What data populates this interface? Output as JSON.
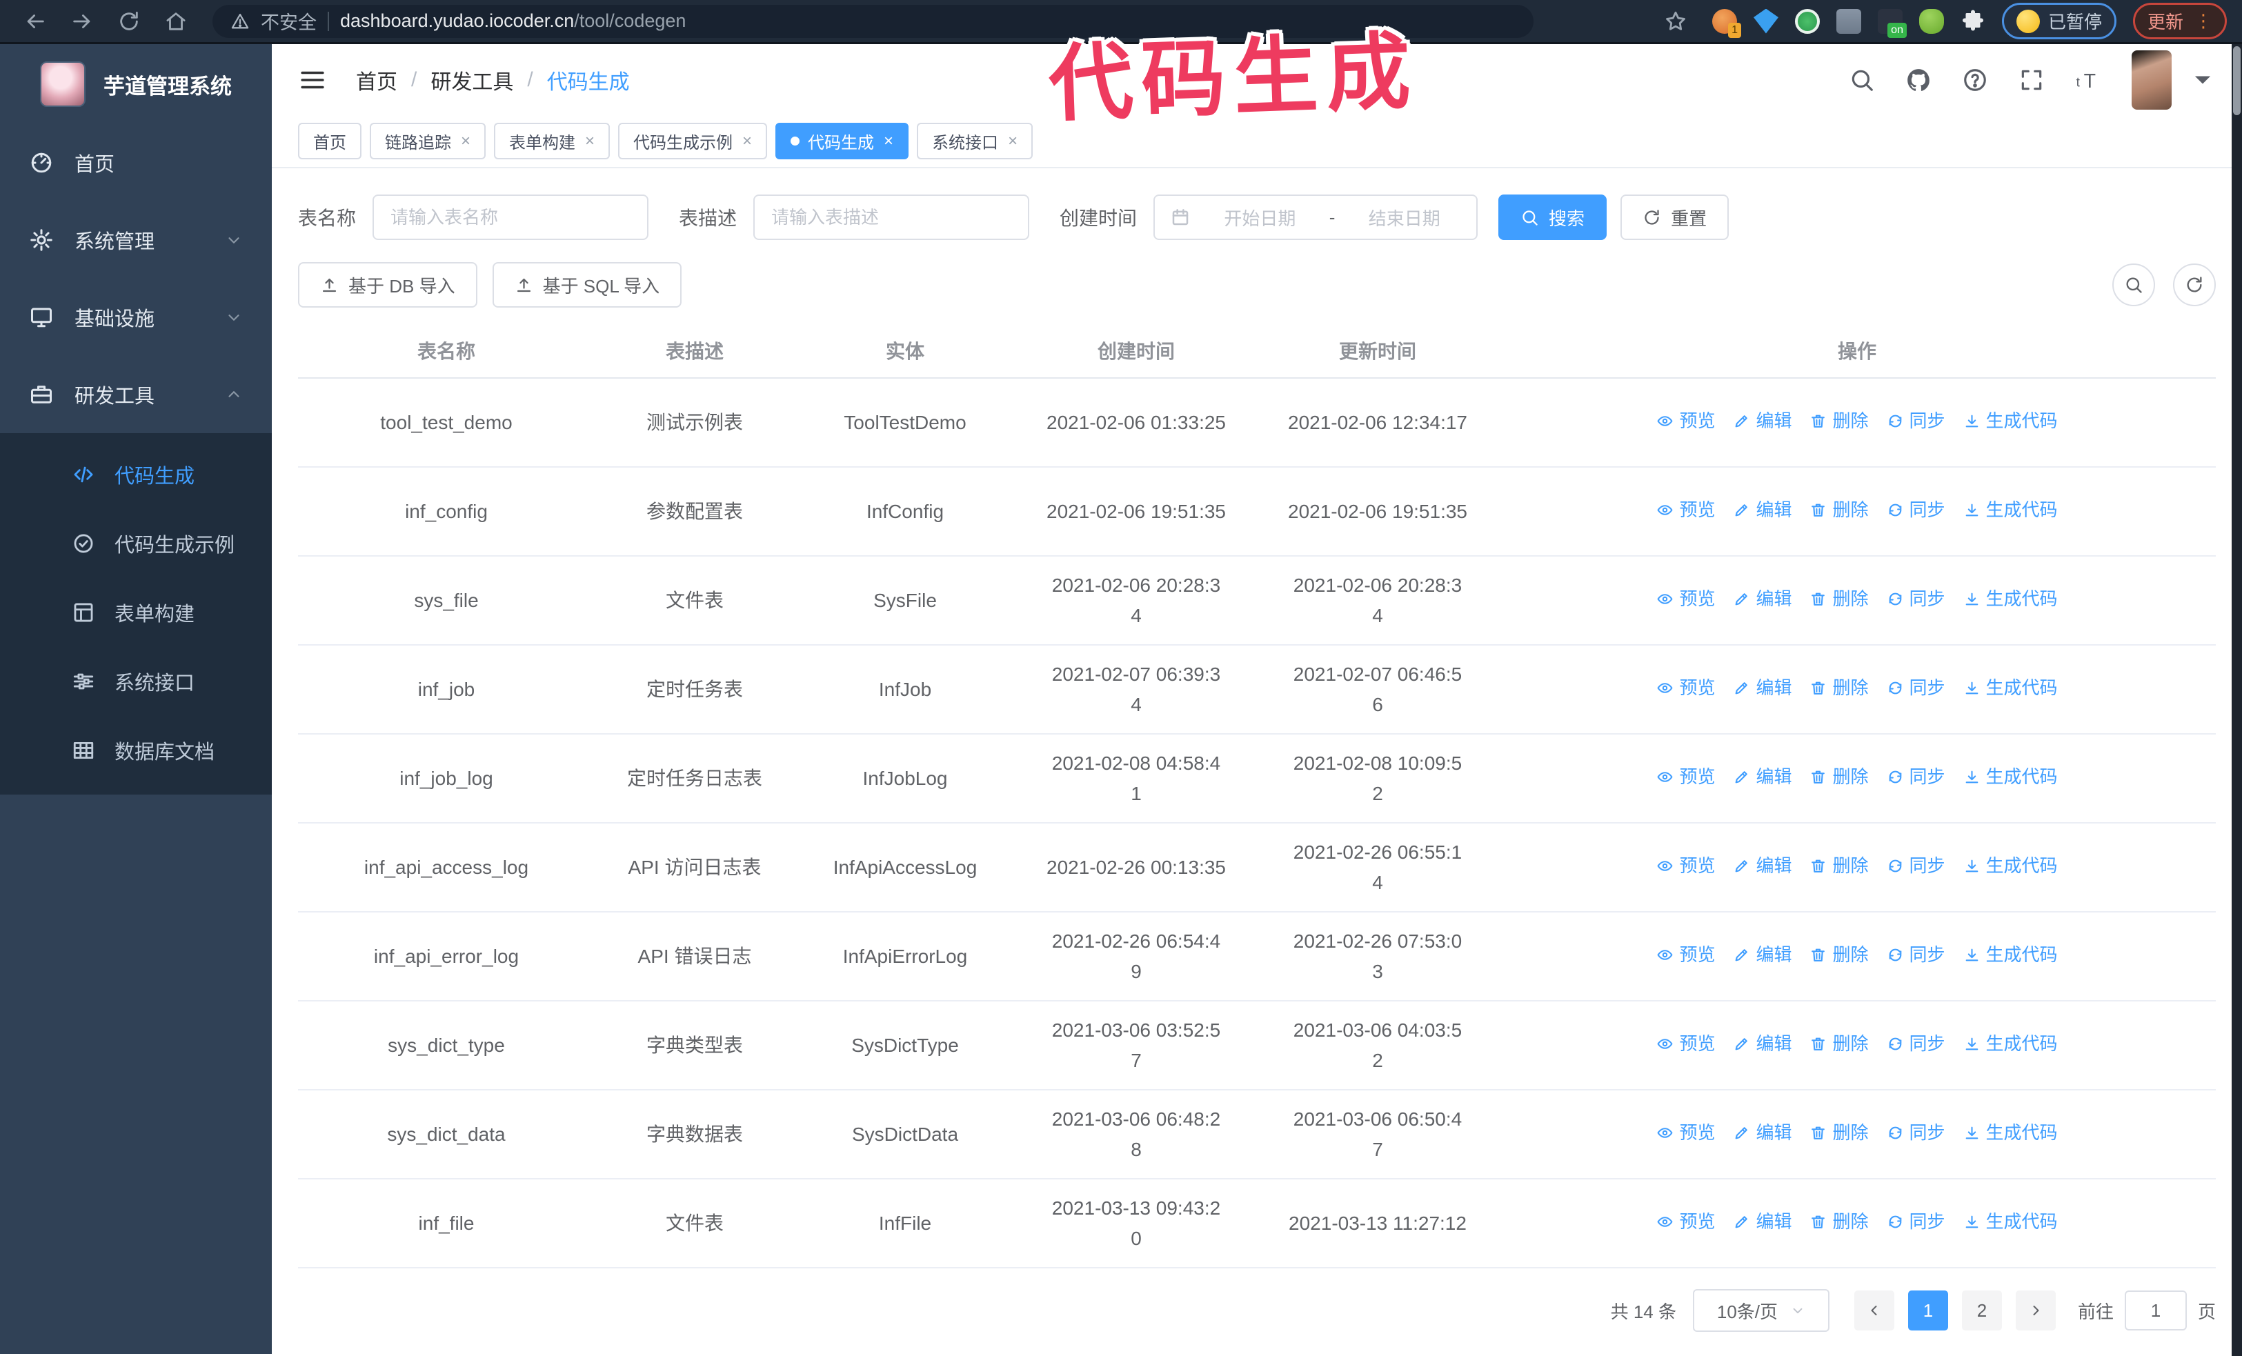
{
  "colors": {
    "accent": "#409eff",
    "sidebar_bg": "#304156",
    "submenu_bg": "#1f2d3d",
    "annotation": "#ee3b5f"
  },
  "annotation": {
    "text": "代码生成"
  },
  "browser": {
    "security_label": "不安全",
    "url_host": "dashboard.yudao.iocoder.cn",
    "url_path": "/tool/codegen",
    "paused_label": "已暂停",
    "update_label": "更新",
    "extension_badge_1": "1",
    "extension_badge_on": "on"
  },
  "sidebar": {
    "title": "芋道管理系统",
    "menu": [
      {
        "key": "home",
        "label": "首页",
        "icon": "dashboard-icon"
      },
      {
        "key": "system",
        "label": "系统管理",
        "icon": "gear-icon",
        "chevron": "chevron-down-icon"
      },
      {
        "key": "infra",
        "label": "基础设施",
        "icon": "monitor-icon",
        "chevron": "chevron-down-icon"
      },
      {
        "key": "dev-tools",
        "label": "研发工具",
        "icon": "toolbox-icon",
        "chevron": "chevron-up-icon"
      }
    ],
    "submenu": [
      {
        "key": "codegen",
        "label": "代码生成",
        "icon": "code-icon",
        "active": true
      },
      {
        "key": "codegen-example",
        "label": "代码生成示例",
        "icon": "badge-check-icon"
      },
      {
        "key": "form-builder",
        "label": "表单构建",
        "icon": "form-icon"
      },
      {
        "key": "api",
        "label": "系统接口",
        "icon": "sliders-icon"
      },
      {
        "key": "db-doc",
        "label": "数据库文档",
        "icon": "database-icon"
      }
    ]
  },
  "header": {
    "breadcrumb": [
      "首页",
      "研发工具",
      "代码生成"
    ]
  },
  "tabs": [
    {
      "key": "home",
      "label": "首页",
      "closable": false,
      "active": false
    },
    {
      "key": "tracing",
      "label": "链路追踪",
      "closable": true,
      "active": false
    },
    {
      "key": "form-builder",
      "label": "表单构建",
      "closable": true,
      "active": false
    },
    {
      "key": "codegen-example",
      "label": "代码生成示例",
      "closable": true,
      "active": false
    },
    {
      "key": "codegen",
      "label": "代码生成",
      "closable": true,
      "active": true
    },
    {
      "key": "api",
      "label": "系统接口",
      "closable": true,
      "active": false
    }
  ],
  "filters": {
    "name_label": "表名称",
    "name_placeholder": "请输入表名称",
    "desc_label": "表描述",
    "desc_placeholder": "请输入表描述",
    "time_label": "创建时间",
    "start_placeholder": "开始日期",
    "range_separator": "-",
    "end_placeholder": "结束日期",
    "search_label": "搜索",
    "reset_label": "重置"
  },
  "toolbar": {
    "import_db_label": "基于 DB 导入",
    "import_sql_label": "基于 SQL 导入"
  },
  "table": {
    "columns": [
      "表名称",
      "表描述",
      "实体",
      "创建时间",
      "更新时间",
      "操作"
    ],
    "actions": [
      {
        "key": "preview",
        "label": "预览",
        "icon": "eye-icon"
      },
      {
        "key": "edit",
        "label": "编辑",
        "icon": "edit-icon"
      },
      {
        "key": "delete",
        "label": "删除",
        "icon": "trash-icon"
      },
      {
        "key": "sync",
        "label": "同步",
        "icon": "sync-icon"
      },
      {
        "key": "generate",
        "label": "生成代码",
        "icon": "download-icon"
      }
    ],
    "rows": [
      {
        "name": "tool_test_demo",
        "desc": "测试示例表",
        "entity": "ToolTestDemo",
        "created": "2021-02-06 01:33:25",
        "updated": "2021-02-06 12:34:17"
      },
      {
        "name": "inf_config",
        "desc": "参数配置表",
        "entity": "InfConfig",
        "created": "2021-02-06 19:51:35",
        "updated": "2021-02-06 19:51:35"
      },
      {
        "name": "sys_file",
        "desc": "文件表",
        "entity": "SysFile",
        "created": "2021-02-06 20:28:3\n4",
        "updated": "2021-02-06 20:28:3\n4"
      },
      {
        "name": "inf_job",
        "desc": "定时任务表",
        "entity": "InfJob",
        "created": "2021-02-07 06:39:3\n4",
        "updated": "2021-02-07 06:46:5\n6"
      },
      {
        "name": "inf_job_log",
        "desc": "定时任务日志表",
        "entity": "InfJobLog",
        "created": "2021-02-08 04:58:4\n1",
        "updated": "2021-02-08 10:09:5\n2"
      },
      {
        "name": "inf_api_access_log",
        "desc": "API 访问日志表",
        "entity": "InfApiAccessLog",
        "created": "2021-02-26 00:13:35",
        "updated": "2021-02-26 06:55:1\n4"
      },
      {
        "name": "inf_api_error_log",
        "desc": "API 错误日志",
        "entity": "InfApiErrorLog",
        "created": "2021-02-26 06:54:4\n9",
        "updated": "2021-02-26 07:53:0\n3"
      },
      {
        "name": "sys_dict_type",
        "desc": "字典类型表",
        "entity": "SysDictType",
        "created": "2021-03-06 03:52:5\n7",
        "updated": "2021-03-06 04:03:5\n2"
      },
      {
        "name": "sys_dict_data",
        "desc": "字典数据表",
        "entity": "SysDictData",
        "created": "2021-03-06 06:48:2\n8",
        "updated": "2021-03-06 06:50:4\n7"
      },
      {
        "name": "inf_file",
        "desc": "文件表",
        "entity": "InfFile",
        "created": "2021-03-13 09:43:2\n0",
        "updated": "2021-03-13 11:27:12"
      }
    ]
  },
  "pagination": {
    "total_label": "共 14 条",
    "page_size_label": "10条/页",
    "pages": [
      "1",
      "2"
    ],
    "active_page": "1",
    "goto_label": "前往",
    "goto_value": "1",
    "page_unit_label": "页"
  }
}
